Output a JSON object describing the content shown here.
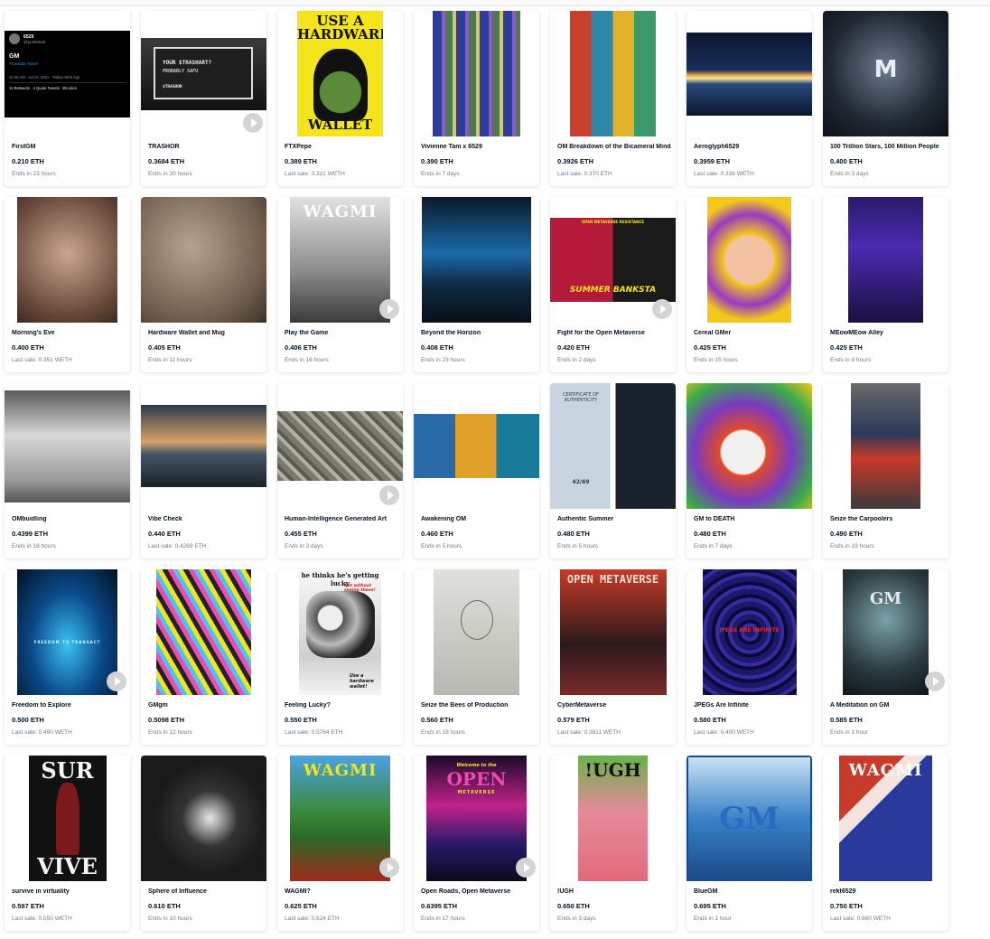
{
  "currency": "ETH",
  "items": [
    {
      "name": "FirstGM",
      "price": "0.210 ETH",
      "sub": "Ends in 23 hours",
      "video": false,
      "art": "tweet",
      "tweet": {
        "handle": "6529",
        "user": "@punk6529",
        "text": "GM",
        "link": "Translate Tweet",
        "meta": "10:45 AM · Jul 22, 2021 · Twitter Web App",
        "stats": "11 Retweets   4 Quote Tweets   85 Likes"
      }
    },
    {
      "name": "TRASHOR",
      "price": "0.3684 ETH",
      "sub": "Ends in 20 hours",
      "video": true,
      "art": "trashor",
      "art_text": "YOUR $TRASHART?",
      "art_text2": "PROBABLY SAFU",
      "art_text3": "$TRASHOR"
    },
    {
      "name": "FTXPepe",
      "price": "0.389 ETH",
      "sub": "Last sale: 0.321 WETH",
      "video": false,
      "art": "ftxpepe",
      "art_text": "USE A HARDWARE",
      "art_text2": "WALLET"
    },
    {
      "name": "Vivienne Tam x 6529",
      "price": "0.390 ETH",
      "sub": "Ends in 7 days",
      "video": false,
      "art": "vivienne"
    },
    {
      "name": "OM Breakdown of the Bicameral Mind",
      "price": "0.3926 ETH",
      "sub": "Last sale: 0.370 ETH",
      "video": false,
      "art": "bicameral"
    },
    {
      "name": "Aeroglyph6529",
      "price": "0.3959 ETH",
      "sub": "Last sale: 0.336 WETH",
      "video": false,
      "art": "aeroglyph"
    },
    {
      "name": "100 Trillion Stars, 100 Million People",
      "price": "0.400 ETH",
      "sub": "Ends in 3 days",
      "video": false,
      "art": "stars"
    },
    {
      "name": "Morning's Eve",
      "price": "0.400 ETH",
      "sub": "Last sale: 0.351 WETH",
      "video": false,
      "art": "morningseve"
    },
    {
      "name": "Hardware Wallet and Mug",
      "price": "0.405 ETH",
      "sub": "Ends in 11 hours",
      "video": false,
      "art": "mug"
    },
    {
      "name": "Play the Game",
      "price": "0.406 ETH",
      "sub": "Ends in 16 hours",
      "video": true,
      "art": "wagmi_game",
      "art_text": "WAGMI"
    },
    {
      "name": "Beyond the Horizon",
      "price": "0.408 ETH",
      "sub": "Ends in 23 hours",
      "video": false,
      "art": "horizon"
    },
    {
      "name": "Fight for the Open Metaverse",
      "price": "0.420 ETH",
      "sub": "Ends in 2 days",
      "video": true,
      "art": "fight",
      "art_text": "OPEN METAVERSE RESISTANCE",
      "art_text2": "SUMMER BANKSTA"
    },
    {
      "name": "Cereal GMer",
      "price": "0.425 ETH",
      "sub": "Ends in 15 hours",
      "video": false,
      "art": "cereal"
    },
    {
      "name": "MEowMEow Alley",
      "price": "0.425 ETH",
      "sub": "Ends in 8 hours",
      "video": false,
      "art": "meow"
    },
    {
      "name": "OMbuidling",
      "price": "0.4399 ETH",
      "sub": "Ends in 18 hours",
      "video": false,
      "art": "ombuilding"
    },
    {
      "name": "Vibe Check",
      "price": "0.440 ETH",
      "sub": "Last sale: 0.4269 ETH",
      "video": false,
      "art": "vibe"
    },
    {
      "name": "Human-Intelligence Generated Art",
      "price": "0.455 ETH",
      "sub": "Ends in 3 days",
      "video": true,
      "art": "aerial"
    },
    {
      "name": "Awakening OM",
      "price": "0.460 ETH",
      "sub": "Ends in 5 hours",
      "video": false,
      "art": "awakening"
    },
    {
      "name": "Authentic Summer",
      "price": "0.480 ETH",
      "sub": "Ends in 5 hours",
      "video": false,
      "art": "authentic",
      "art_text": "CERTIFICATE OF AUTHENTICITY",
      "art_text2": "42/69"
    },
    {
      "name": "GM to DEATH",
      "price": "0.480 ETH",
      "sub": "Ends in 7 days",
      "video": false,
      "art": "gmdeath"
    },
    {
      "name": "Seize the Carpoolers",
      "price": "0.490 ETH",
      "sub": "Ends in 19 hours",
      "video": false,
      "art": "carpool"
    },
    {
      "name": "Freedom to Explore",
      "price": "0.500 ETH",
      "sub": "Last sale: 0.490 WETH",
      "video": true,
      "art": "freedom",
      "art_text": "FREEDOM TO TRANSACT"
    },
    {
      "name": "GMgm",
      "price": "0.5098 ETH",
      "sub": "Ends in 12 hours",
      "video": false,
      "art": "gmgm"
    },
    {
      "name": "Feeling Lucky?",
      "price": "0.550 ETH",
      "sub": "Last sale: 0.5764 ETH",
      "video": false,
      "art": "lucky",
      "art_text": "he thinks he's getting lucky",
      "art_text2": "Not without seeing these!",
      "art_text3": "Use a hardware wallet!"
    },
    {
      "name": "Seize the Bees of Production",
      "price": "0.560 ETH",
      "sub": "Ends in 18 hours",
      "video": false,
      "art": "bees"
    },
    {
      "name": "CyberMetaverse",
      "price": "0.579 ETH",
      "sub": "Last sale: 0.3811 WETH",
      "video": false,
      "art": "cyber",
      "art_text": "OPEN METAVERSE"
    },
    {
      "name": "JPEGs Are Infinite",
      "price": "0.580 ETH",
      "sub": "Last sale: 0.400 WETH",
      "video": false,
      "art": "jpegs",
      "art_text": "JPEGS ARE INFINITE"
    },
    {
      "name": "A Meditation on GM",
      "price": "0.585 ETH",
      "sub": "Ends in 1 hour",
      "video": true,
      "art": "meditation",
      "art_text": "GM"
    },
    {
      "name": "survive in virtuality",
      "price": "0.597 ETH",
      "sub": "Last sale: 0.550 WETH",
      "video": false,
      "art": "survive",
      "art_text": "SUR",
      "art_text2": "VIVE"
    },
    {
      "name": "Sphere of Influence",
      "price": "0.610 ETH",
      "sub": "Ends in 10 hours",
      "video": false,
      "art": "sphere"
    },
    {
      "name": "WAGMI?",
      "price": "0.625 ETH",
      "sub": "Last sale: 0.624 ETH",
      "video": true,
      "art": "wagmipepe",
      "art_text": "WAGMI"
    },
    {
      "name": "Open Roads, Open Metaverse",
      "price": "0.6395 ETH",
      "sub": "Ends in 17 hours",
      "video": true,
      "art": "openroads",
      "art_text": "Welcome to the",
      "art_text2": "OPEN",
      "art_text3": "METAVERSE"
    },
    {
      "name": "!UGH",
      "price": "0.650 ETH",
      "sub": "Ends in 3 days",
      "video": false,
      "art": "ugh",
      "art_text": "!UGH"
    },
    {
      "name": "BlueGM",
      "price": "0.695 ETH",
      "sub": "Ends in 1 hour",
      "video": false,
      "art": "bluegm",
      "art_text": "GM"
    },
    {
      "name": "rekt6529",
      "price": "0.750 ETH",
      "sub": "Last sale: 0.660 WETH",
      "video": false,
      "art": "rekt",
      "art_text": "WAGMI"
    }
  ]
}
